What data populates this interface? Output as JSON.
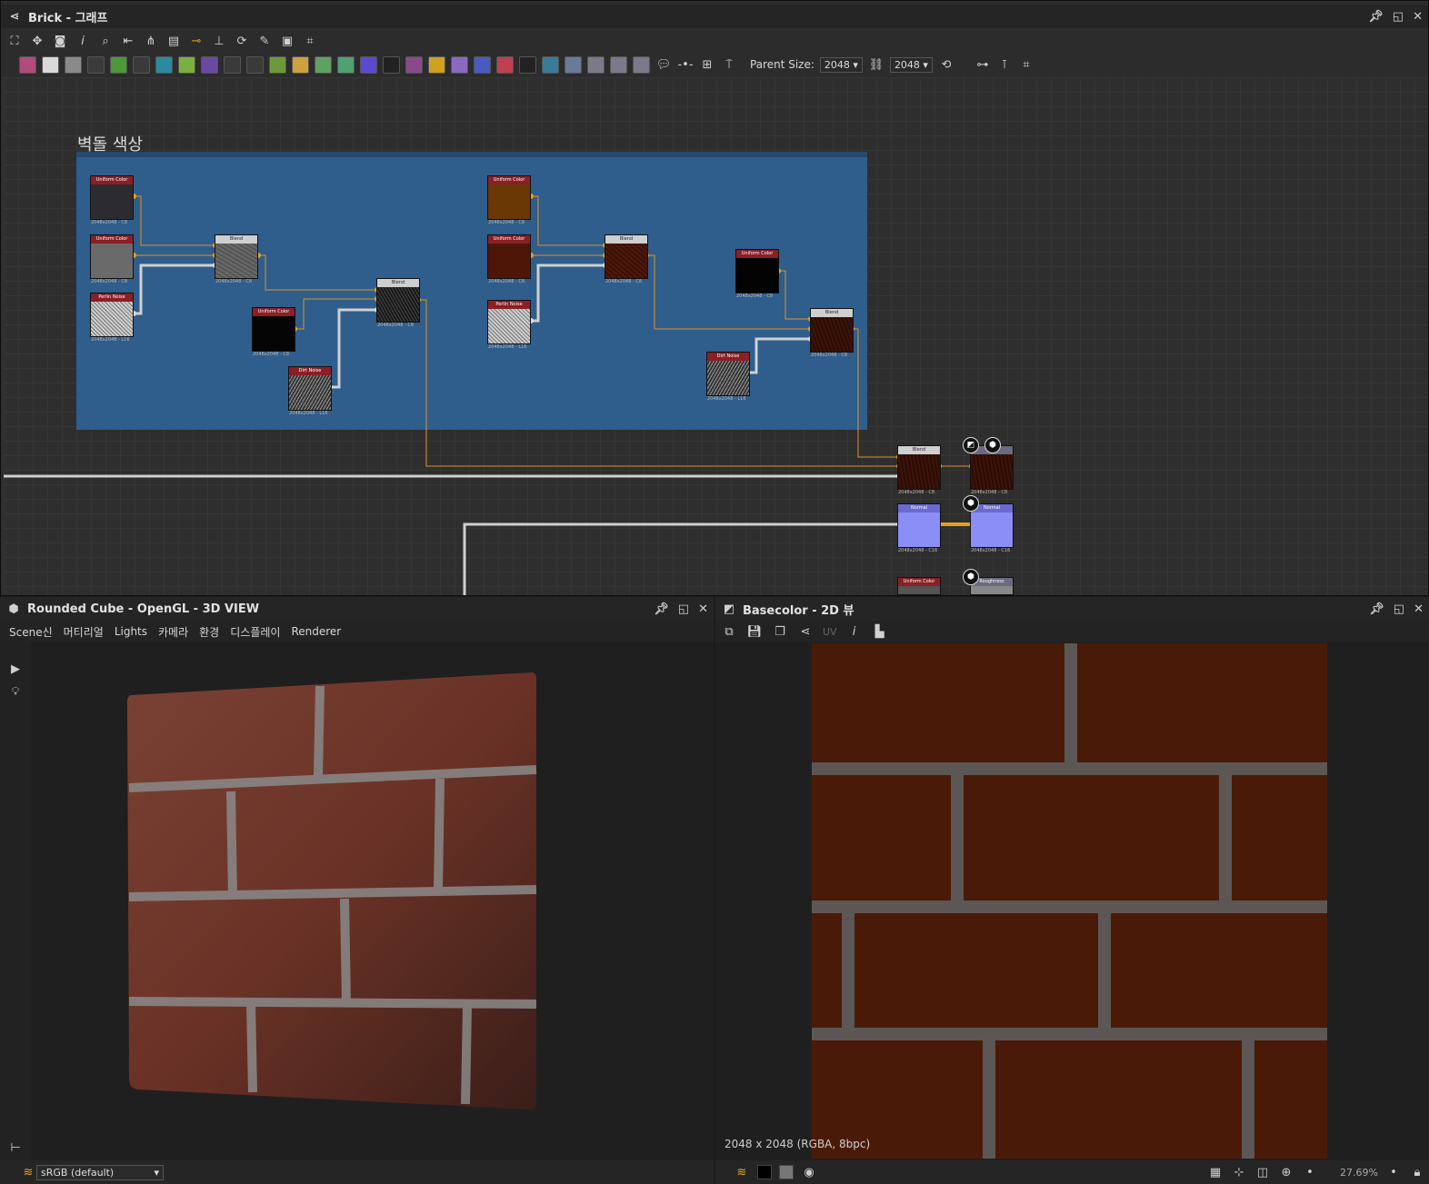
{
  "graph_panel": {
    "title": "Brick - 그래프",
    "parent_size_label": "Parent Size:",
    "parent_size_w": "2048",
    "parent_size_h": "2048",
    "frame_title": "벽돌 색상",
    "nodes": [
      {
        "header": "Uniform Color",
        "caption": "2048x2048 - C8"
      },
      {
        "header": "Uniform Color",
        "caption": "2048x2048 - C8"
      },
      {
        "header": "Perlin Noise",
        "caption": "2048x2048 - L16"
      },
      {
        "header": "Blend",
        "caption": "2048x2048 - C8"
      },
      {
        "header": "Uniform Color",
        "caption": "2048x2048 - C8"
      },
      {
        "header": "Blend",
        "caption": "2048x2048 - C8"
      },
      {
        "header": "Dirt Noise",
        "caption": "2048x2048 - L16"
      },
      {
        "header": "Uniform Color",
        "caption": "2048x2048 - C8"
      },
      {
        "header": "Uniform Color",
        "caption": "2048x2048 - C8"
      },
      {
        "header": "Perlin Noise",
        "caption": "2048x2048 - L16"
      },
      {
        "header": "Blend",
        "caption": "2048x2048 - C8"
      },
      {
        "header": "Uniform Color",
        "caption": "2048x2048 - C8"
      },
      {
        "header": "Blend",
        "caption": "2048x2048 - C8"
      },
      {
        "header": "Dirt Noise",
        "caption": "2048x2048 - L16"
      },
      {
        "header": "Blend",
        "caption": "2048x2048 - C8"
      },
      {
        "header": "",
        "caption": "2048x2048 - C8"
      },
      {
        "header": "Normal",
        "caption": "2048x2048 - C16"
      },
      {
        "header": "Normal",
        "caption": "2048x2048 - C16"
      },
      {
        "header": "Uniform Color",
        "caption": ""
      },
      {
        "header": "Roughness",
        "caption": ""
      }
    ]
  },
  "view3d": {
    "title": "Rounded Cube - OpenGL - 3D VIEW",
    "menu": [
      "Scene신",
      "머티리얼",
      "Lights",
      "카메라",
      "환경",
      "디스플레이",
      "Renderer"
    ],
    "colorspace": "sRGB (default)"
  },
  "view2d": {
    "title": "Basecolor - 2D 뷰",
    "uv_label": "UV",
    "image_info": "2048 x 2048 (RGBA, 8bpc)",
    "zoom": "27.69%"
  },
  "colors": {
    "frame_blue": "#2f5d8c",
    "wire_orange": "#d8952a",
    "wire_gray": "#d0d0d0",
    "node_header_red": "#8a1f26",
    "brick": "#5a1d0c",
    "mortar": "#6a6a6a"
  }
}
